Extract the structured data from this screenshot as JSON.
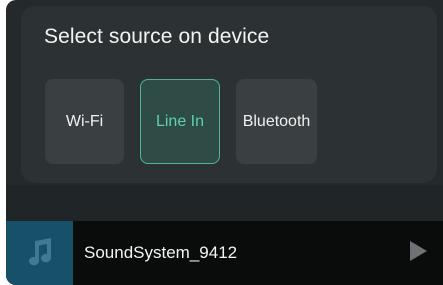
{
  "source_panel": {
    "title": "Select source on device",
    "options": [
      {
        "label": "Wi-Fi",
        "selected": false
      },
      {
        "label": "Line In",
        "selected": true
      },
      {
        "label": "Bluetooth",
        "selected": false
      }
    ]
  },
  "player": {
    "device_name": "SoundSystem_9412",
    "album_icon": "music-note-icon",
    "play_icon": "play-icon"
  },
  "colors": {
    "accent": "#5fd0b6",
    "panel": "#2c3234",
    "background": "#242a2c",
    "album_bg": "#165069"
  }
}
